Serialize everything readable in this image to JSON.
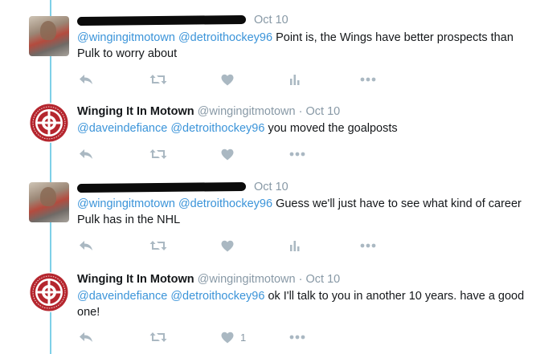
{
  "tweets": [
    {
      "author_name": "",
      "author_handle": "",
      "name_redacted": true,
      "avatar": "photo-avatar",
      "time": "Oct 10",
      "mentions": [
        "@wingingitmotown",
        "@detroithockey96"
      ],
      "text": "Point is, the Wings have better prospects than Pulk to worry about",
      "actions": [
        "reply-icon",
        "retweet-icon",
        "like-icon",
        "analytics-icon",
        "more-icon"
      ],
      "like_count": ""
    },
    {
      "author_name": "Winging It In Motown",
      "author_handle": "@wingingitmotown",
      "separator": "·",
      "name_redacted": false,
      "avatar": "team-logo-avatar",
      "time": "Oct 10",
      "mentions": [
        "@daveindefiance",
        "@detroithockey96"
      ],
      "text": "you moved the goalposts",
      "actions": [
        "reply-icon",
        "retweet-icon",
        "like-icon",
        "more-icon"
      ],
      "like_count": ""
    },
    {
      "author_name": "",
      "author_handle": "",
      "name_redacted": true,
      "avatar": "photo-avatar",
      "time": "Oct 10",
      "mentions": [
        "@wingingitmotown",
        "@detroithockey96"
      ],
      "text": "Guess we'll just have to see what kind of career Pulk has in the NHL",
      "actions": [
        "reply-icon",
        "retweet-icon",
        "like-icon",
        "analytics-icon",
        "more-icon"
      ],
      "like_count": ""
    },
    {
      "author_name": "Winging It In Motown",
      "author_handle": "@wingingitmotown",
      "separator": "·",
      "name_redacted": false,
      "avatar": "team-logo-avatar",
      "time": "Oct 10",
      "mentions": [
        "@daveindefiance",
        "@detroithockey96"
      ],
      "text": "ok I'll talk to you in another 10 years. have a good one!",
      "actions": [
        "reply-icon",
        "retweet-icon",
        "like-icon",
        "more-icon"
      ],
      "like_count": "1"
    }
  ],
  "colors": {
    "mention": "#3b94d9",
    "thread_line": "#7fd0e8",
    "icon": "#aab8c2",
    "logo_red": "#b5262e"
  }
}
